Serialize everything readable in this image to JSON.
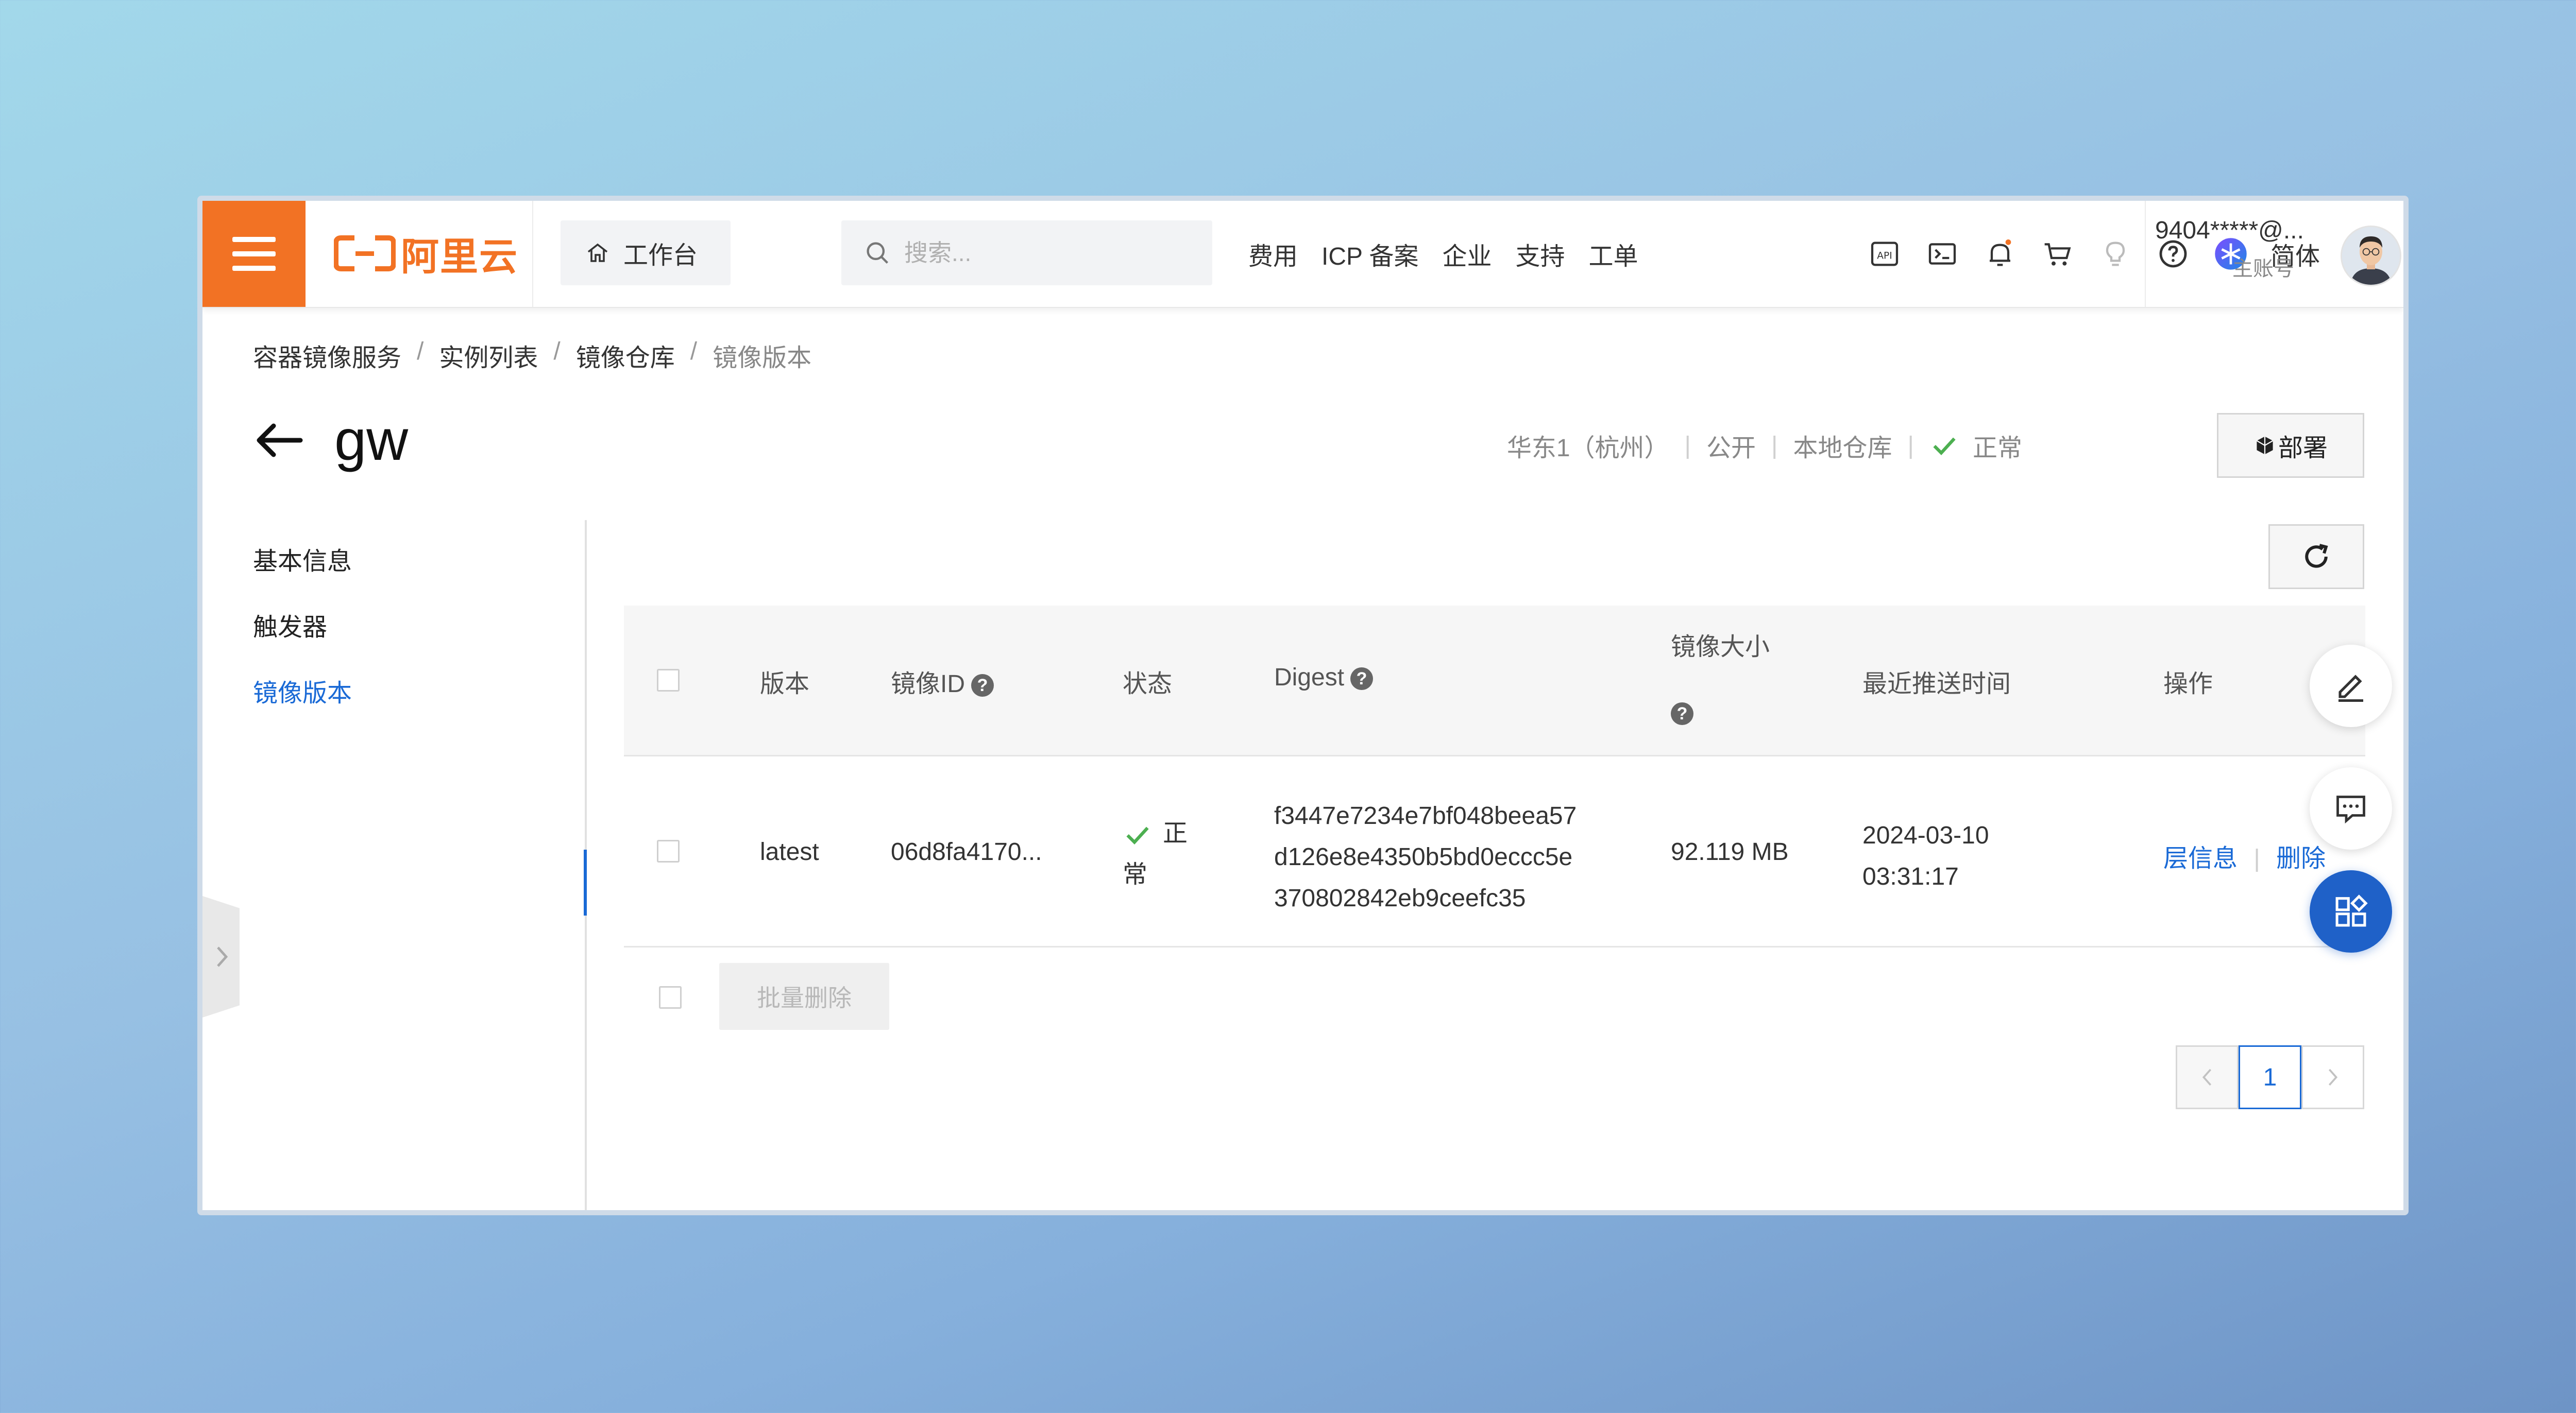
{
  "topbar": {
    "logo_text": "阿里云",
    "workbench_label": "工作台",
    "search_placeholder": "搜索...",
    "nav_links": [
      "费用",
      "ICP 备案",
      "企业",
      "支持",
      "工单"
    ],
    "language": "简体",
    "account_id": "9404*****@...",
    "account_role": "主账号",
    "icons": [
      "api-icon",
      "terminal-icon",
      "bell-icon",
      "cart-icon",
      "lightbulb-icon",
      "help-icon",
      "ai-assistant-icon"
    ],
    "accent_color": "#f27224"
  },
  "breadcrumb": {
    "items": [
      "容器镜像服务",
      "实例列表",
      "镜像仓库"
    ],
    "current": "镜像版本"
  },
  "header": {
    "title": "gw",
    "region": "华东1（杭州）",
    "visibility": "公开",
    "repo_type": "本地仓库",
    "status": "正常",
    "deploy_label": "部署"
  },
  "sidenav": {
    "items": [
      "基本信息",
      "触发器",
      "镜像版本"
    ],
    "active": "镜像版本"
  },
  "table": {
    "columns": {
      "version": "版本",
      "image_id": "镜像ID",
      "status": "状态",
      "digest": "Digest",
      "size": "镜像大小",
      "pushed": "最近推送时间",
      "actions": "操作"
    },
    "rows": [
      {
        "version": "latest",
        "image_id": "06d8fa4170...",
        "status_line1": "正",
        "status_line2": "常",
        "digest_line1": "f3447e7234e7bf048beea57",
        "digest_line2": "d126e8e4350b5bd0eccc5e",
        "digest_line3": "370802842eb9ceefc35",
        "size": "92.119 MB",
        "pushed_date": "2024-03-10",
        "pushed_time": "03:31:17",
        "action_layers": "层信息",
        "action_delete": "删除"
      }
    ],
    "batch_delete_label": "批量删除"
  },
  "pagination": {
    "current_page": "1"
  },
  "colors": {
    "primary": "#1a6ad6",
    "success": "#4caf50"
  }
}
